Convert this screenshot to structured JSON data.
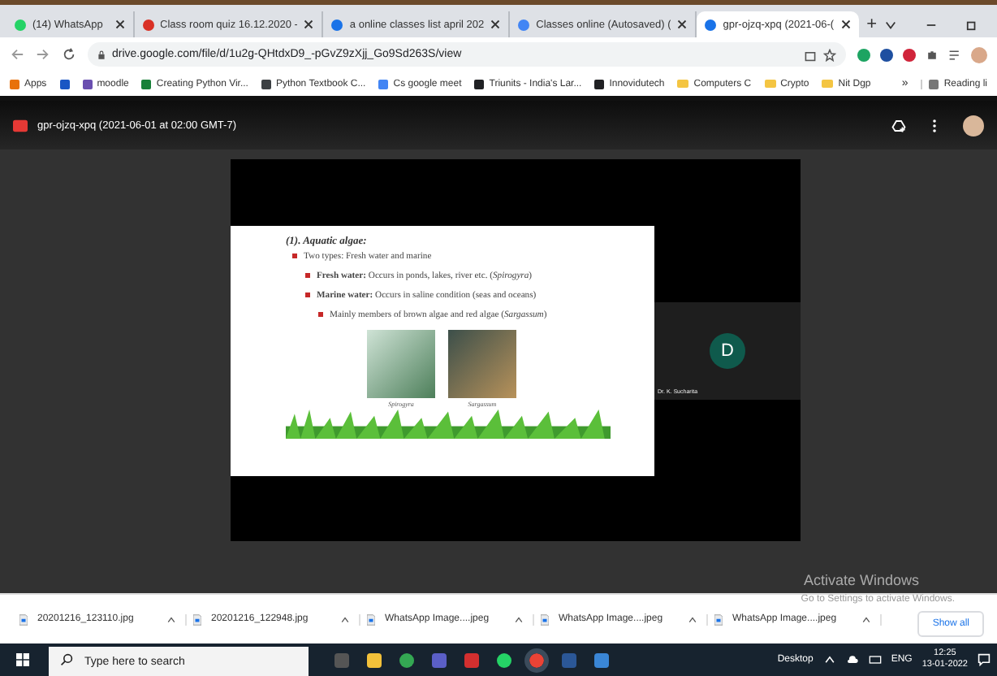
{
  "tabs": [
    {
      "label": "(14) WhatsApp",
      "kind": "whatsapp",
      "selected": false
    },
    {
      "label": "Class room quiz 16.12.2020 -",
      "kind": "gmail",
      "selected": false
    },
    {
      "label": "a online classes list april 202",
      "kind": "drive",
      "selected": false
    },
    {
      "label": "Classes online (Autosaved) (",
      "kind": "docs",
      "selected": false
    },
    {
      "label": "gpr-ojzq-xpq (2021-06-(",
      "kind": "drive",
      "selected": true
    }
  ],
  "new_tab": "+",
  "address": "drive.google.com/file/d/1u2g-QHtdxD9_-pGvZ9zXjj_Go9Sd263S/view",
  "bookmarks": [
    {
      "label": "Apps",
      "kind": "grid"
    },
    {
      "kind": "letter"
    },
    {
      "label": "moodle",
      "kind": "moodle"
    },
    {
      "label": "Creating Python Vir...",
      "kind": "link"
    },
    {
      "label": "Python Textbook C...",
      "kind": "globe"
    },
    {
      "label": "Cs google meet",
      "kind": "g"
    },
    {
      "label": "Triunits - India's Lar...",
      "kind": "b"
    },
    {
      "label": "Innovidutech",
      "kind": "t"
    },
    {
      "label": "Computers C",
      "kind": "folder"
    },
    {
      "label": "Crypto",
      "kind": "folder"
    },
    {
      "label": "Nit Dgp",
      "kind": "folder"
    }
  ],
  "bookmarks_more": "»",
  "reading_list": "Reading li",
  "viewer": {
    "title": "gpr-ojzq-xpq (2021-06-01 at 02:00 GMT-7)"
  },
  "slide": {
    "heading": "(1). Aquatic algae:",
    "bullets": [
      {
        "text": "Two types: Fresh water and marine",
        "children": [
          {
            "text": "**Fresh water:** Occurs in ponds, lakes, river etc. (*Spirogyra*)"
          },
          {
            "text": "**Marine water:** Occurs in saline condition (seas and oceans)",
            "children": [
              {
                "text": "Mainly members of brown algae and red algae (*Sargassum*)"
              }
            ]
          }
        ]
      }
    ],
    "images": [
      {
        "caption": "Spirogyra",
        "kind": "green"
      },
      {
        "caption": "Sargassum",
        "kind": "brown"
      }
    ]
  },
  "participant": {
    "initial": "D",
    "name": "Dr. K. Sucharita"
  },
  "activate": {
    "title": "Activate Windows",
    "subtitle": "Go to Settings to activate Windows."
  },
  "downloads": [
    "20201216_123110.jpg",
    "20201216_122948.jpg",
    "WhatsApp Image....jpeg",
    "WhatsApp Image....jpeg",
    "WhatsApp Image....jpeg"
  ],
  "show_all": "Show all",
  "taskbar": {
    "search_placeholder": "Type here to search",
    "desktop": "Desktop",
    "language": "ENG",
    "time": "12:25",
    "date": "13-01-2022"
  }
}
